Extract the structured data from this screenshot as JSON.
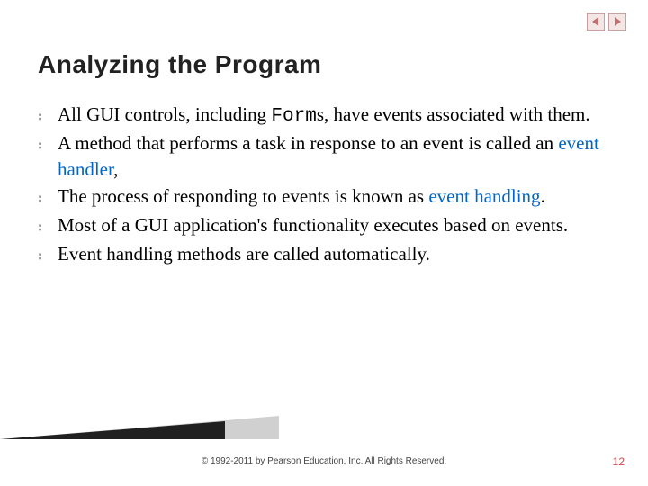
{
  "title": "Analyzing the Program",
  "bullets": [
    {
      "pre": "All GUI controls, including ",
      "mono": "Form",
      "mid": "s, have events associated with them.",
      "hl": "",
      "post": ""
    },
    {
      "pre": "A method that performs a task in response to an event is called an ",
      "mono": "",
      "mid": "",
      "hl": "event handler",
      "post": ","
    },
    {
      "pre": "The process of responding to events is known as ",
      "mono": "",
      "mid": "",
      "hl": "event handling",
      "post": "."
    },
    {
      "pre": "Most of a GUI application's functionality executes based on events.",
      "mono": "",
      "mid": "",
      "hl": "",
      "post": ""
    },
    {
      "pre": "Event handling methods are called automatically.",
      "mono": "",
      "mid": "",
      "hl": "",
      "post": ""
    }
  ],
  "footer": "© 1992-2011 by Pearson Education, Inc. All Rights Reserved.",
  "page": "12",
  "bullet_char": "։"
}
